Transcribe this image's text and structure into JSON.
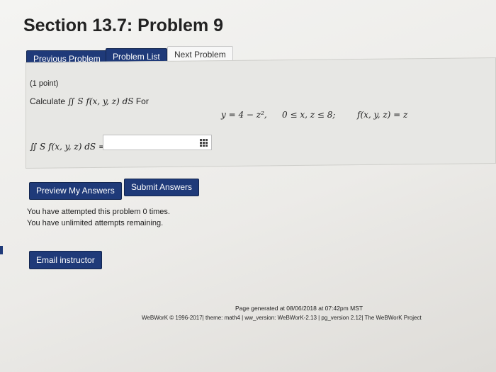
{
  "page": {
    "title": "Section 13.7: Problem 9"
  },
  "nav": {
    "previous": "Previous Problem",
    "list": "Problem List",
    "next": "Next Problem"
  },
  "problem": {
    "points": "(1 point)",
    "calculate_word": "Calculate",
    "integral_expr": "∬ S f(x, y, z) dS",
    "for_word": "For",
    "eq_y": "y = 4 − z²,",
    "eq_range": "0 ≤ x, z ≤ 8;",
    "eq_f": "f(x, y, z) = z",
    "answer_label": "∬ S f(x, y, z) dS =",
    "answer_value": ""
  },
  "actions": {
    "preview": "Preview My Answers",
    "submit": "Submit Answers"
  },
  "attempts": {
    "line1": "You have attempted this problem 0 times.",
    "line2": "You have unlimited attempts remaining."
  },
  "email": {
    "label": "Email instructor"
  },
  "footer": {
    "generated": "Page generated at 08/06/2018 at 07:42pm MST",
    "copyright": "WeBWorK © 1996-2017| theme: math4 | ww_version: WeBWorK-2.13 | pg_version 2.12| The WeBWorK Project"
  },
  "icons": {
    "answer_grid": "grid-icon"
  },
  "colors": {
    "button_dark": "#1f3a79",
    "button_light": "#f7f7f7"
  }
}
